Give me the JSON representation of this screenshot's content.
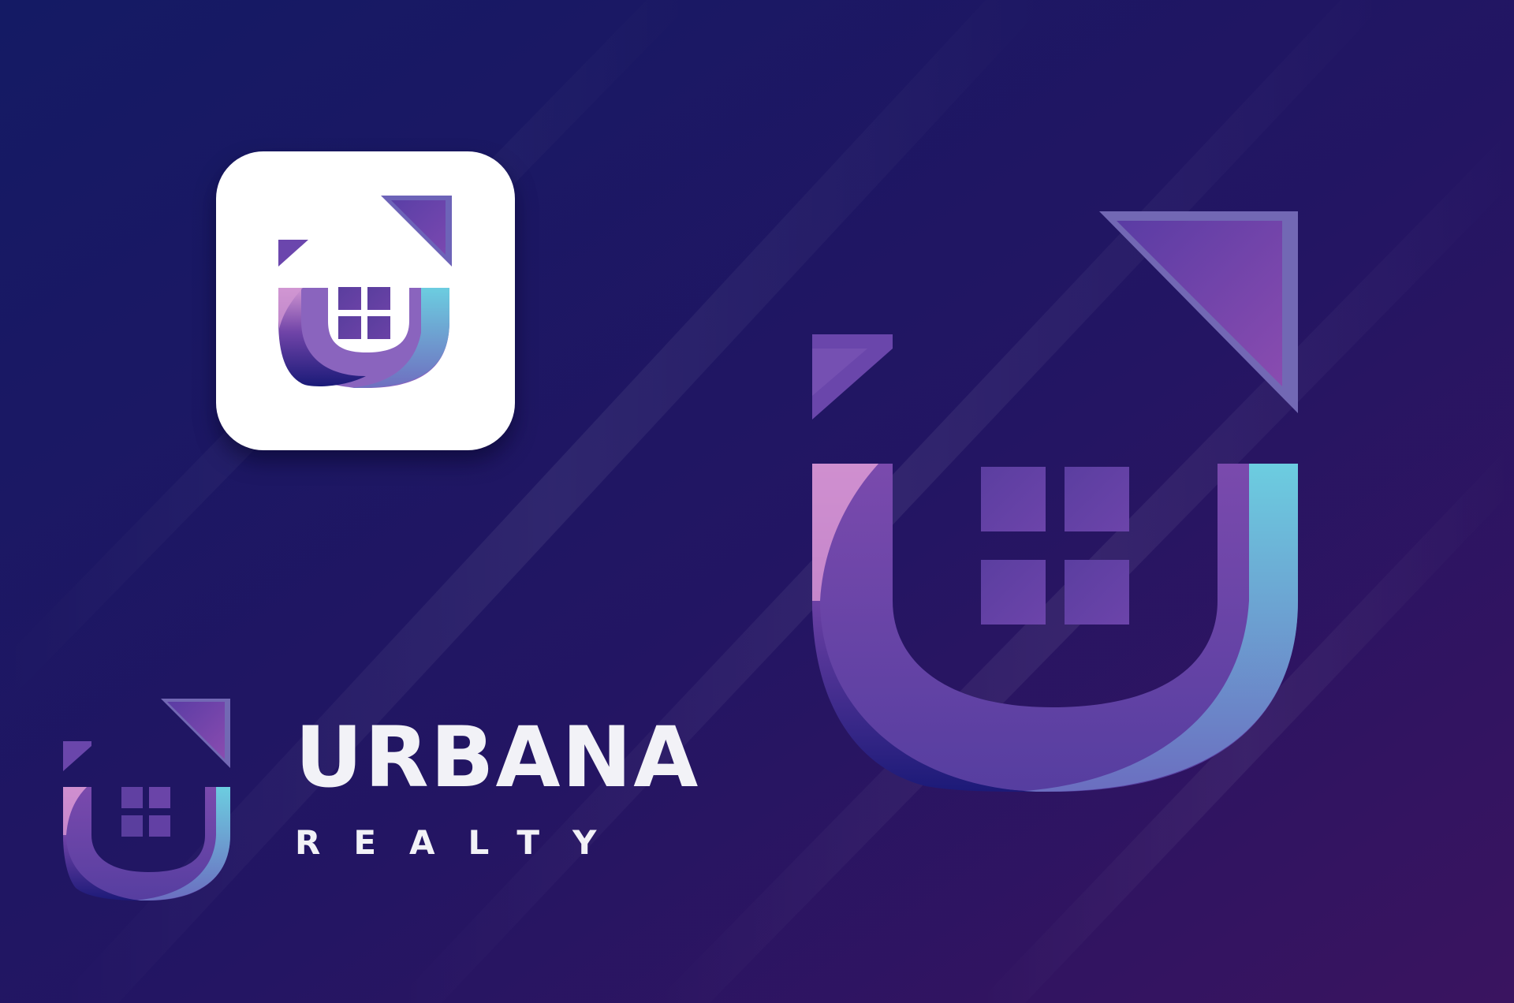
{
  "brand": {
    "name": "URBANA",
    "tagline": "REALTY"
  },
  "logo_symbol": "house-u-logo-icon",
  "colors": {
    "background_start": "#141a64",
    "background_end": "#3a1460",
    "app_icon_background": "#ffffff",
    "mark_pink": "#cf8fcf",
    "mark_purple": "#7244a6",
    "mark_deep_blue": "#1c1a78",
    "mark_cyan": "#6ccde0",
    "text": "#f2f2f7"
  }
}
